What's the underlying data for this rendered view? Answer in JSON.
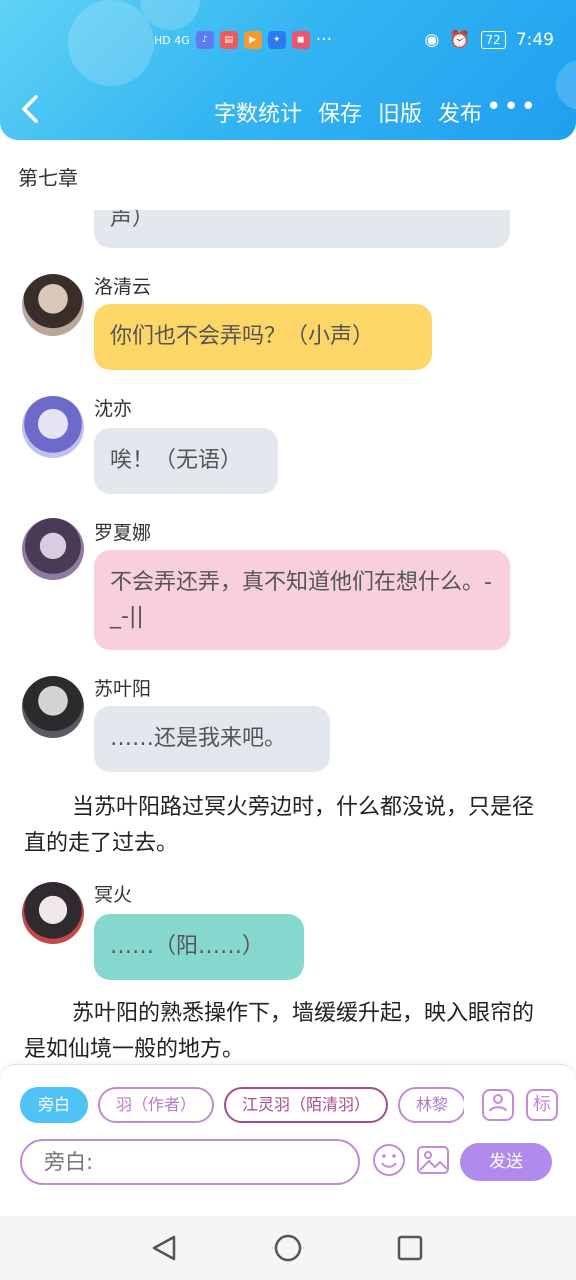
{
  "status": {
    "signal_text": "HD 4G",
    "more_indicator": "···",
    "battery": "72",
    "time": "7:49"
  },
  "toolbar": {
    "word_count": "字数统计",
    "save": "保存",
    "old_version": "旧版",
    "publish": "发布"
  },
  "chapter_title": "第七章",
  "messages": [
    {
      "type": "bubble",
      "text": "声）",
      "color": "#e3e8ef"
    },
    {
      "type": "chat",
      "name": "洛清云",
      "text": "你们也不会弄吗？（小声）",
      "color": "#fcd768"
    },
    {
      "type": "chat",
      "name": "沈亦",
      "text": "唉！（无语）",
      "color": "#e3e8ef"
    },
    {
      "type": "chat",
      "name": "罗夏娜",
      "text": "不会弄还弄，真不知道他们在想什么。-_-||",
      "color": "#f8d0dc"
    },
    {
      "type": "chat",
      "name": "苏叶阳",
      "text": "……还是我来吧。",
      "color": "#e3e8ef"
    },
    {
      "type": "narration",
      "text": "当苏叶阳路过冥火旁边时，什么都没说，只是径直的走了过去。"
    },
    {
      "type": "chat",
      "name": "冥火",
      "text": "……（阳……）",
      "color": "#86d8cf"
    },
    {
      "type": "narration",
      "text": "苏叶阳的熟悉操作下，墙缓缓升起，映入眼帘的是如仙境一般的地方。"
    }
  ],
  "roles": [
    {
      "label": "旁白",
      "active": true
    },
    {
      "label": "羽（作者）"
    },
    {
      "label": "江灵羽（陌清羽）"
    },
    {
      "label": "林黎"
    }
  ],
  "mark_button": "标",
  "input": {
    "placeholder": "旁白:"
  },
  "send_label": "发送"
}
